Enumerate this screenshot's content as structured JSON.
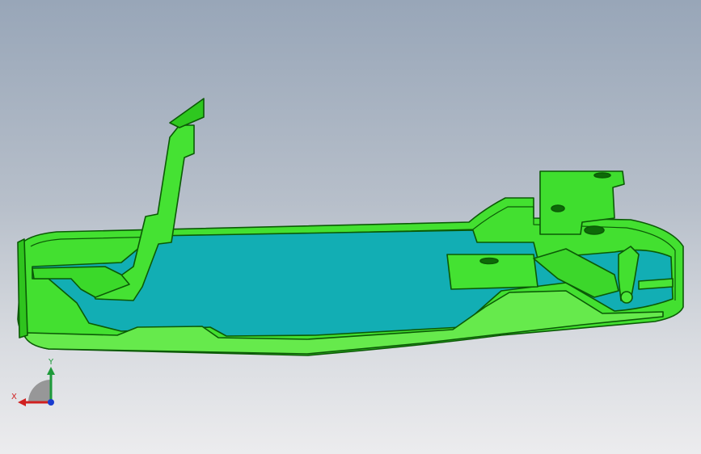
{
  "viewport": {
    "background_top": "#98a6b8",
    "background_bottom": "#ececee"
  },
  "model": {
    "part_color": "#3ddc2a",
    "part_edge_color": "#0b5a06",
    "cavity_color": "#12aeb4"
  },
  "triad": {
    "x_label": "X",
    "y_label": "Y",
    "x_color": "#d02020",
    "y_color": "#1e9a3a",
    "z_color": "#1a3cd0"
  }
}
